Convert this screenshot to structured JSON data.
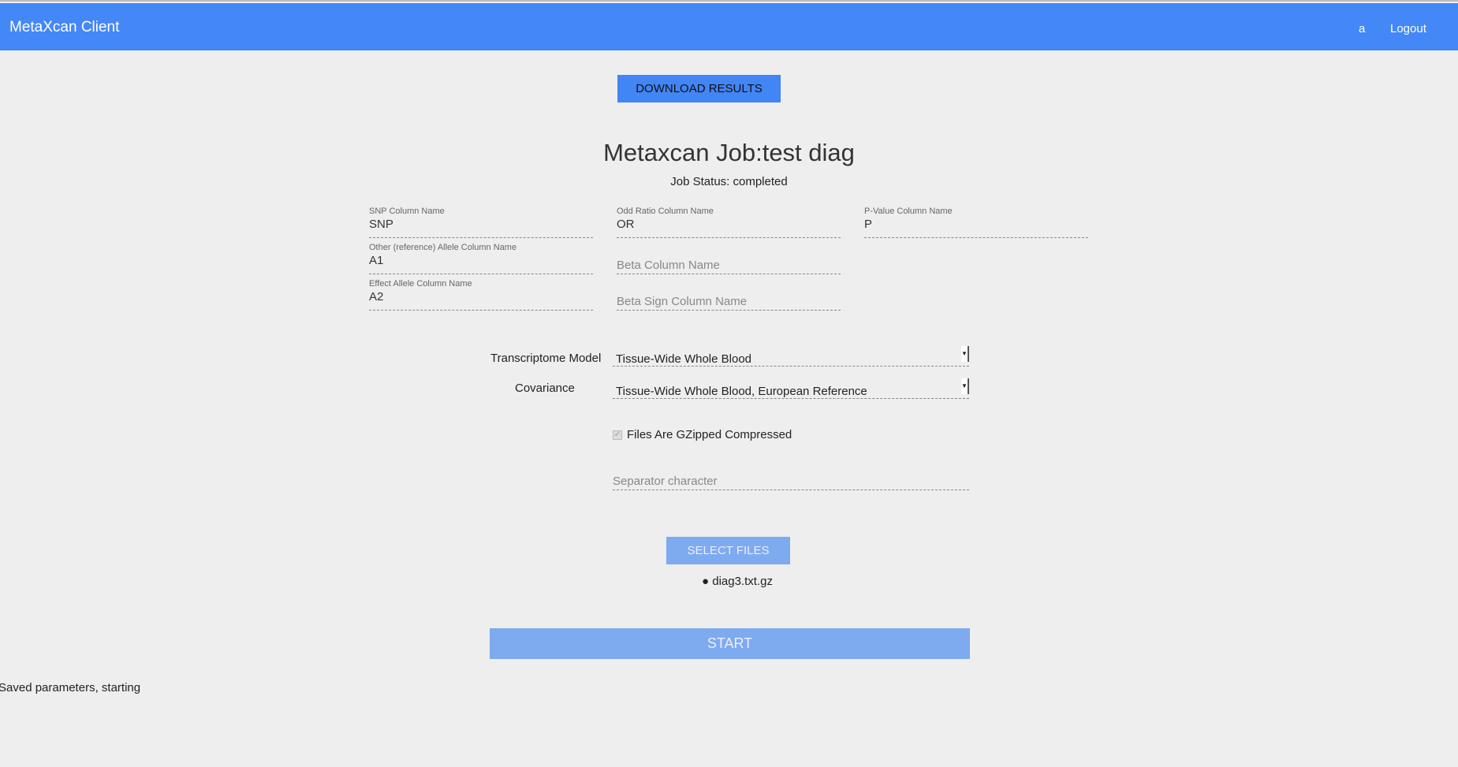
{
  "navbar": {
    "title": "MetaXcan Client",
    "user": "a",
    "logout": "Logout"
  },
  "download_label": "DOWNLOAD RESULTS",
  "job": {
    "title": "Metaxcan Job:test diag",
    "status": "Job Status: completed"
  },
  "fields": {
    "snp": {
      "label": "SNP Column Name",
      "value": "SNP"
    },
    "or": {
      "label": "Odd Ratio Column Name",
      "value": "OR"
    },
    "pval": {
      "label": "P-Value Column Name",
      "value": "P"
    },
    "other_allele": {
      "label": "Other (reference) Allele Column Name",
      "value": "A1"
    },
    "beta": {
      "placeholder": "Beta Column Name"
    },
    "effect_allele": {
      "label": "Effect Allele Column Name",
      "value": "A2"
    },
    "beta_sign": {
      "placeholder": "Beta Sign Column Name"
    }
  },
  "transcriptome": {
    "label": "Transcriptome Model",
    "value": "Tissue-Wide Whole Blood"
  },
  "covariance": {
    "label": "Covariance",
    "value": "Tissue-Wide Whole Blood, European Reference"
  },
  "gzip": {
    "label": "Files Are GZipped Compressed",
    "checked": true
  },
  "separator": {
    "placeholder": "Separator character"
  },
  "select_files_label": "SELECT FILES",
  "files": [
    "diag3.txt.gz"
  ],
  "start_label": "START",
  "message": "Saved parameters, starting"
}
